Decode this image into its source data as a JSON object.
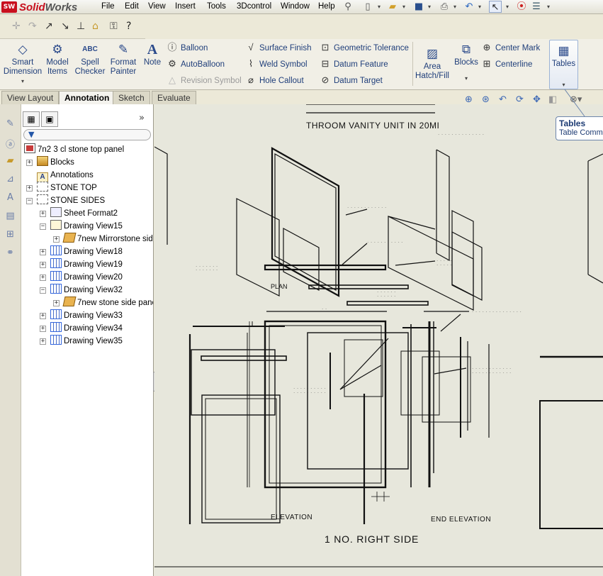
{
  "app": {
    "brand_ds": "SW",
    "brand_solid": "Solid",
    "brand_works": "Works"
  },
  "menu": [
    "File",
    "Edit",
    "View",
    "Insert",
    "Tools",
    "3Dcontrol",
    "Window",
    "Help"
  ],
  "ribbon": {
    "smart_dimension": "Smart Dimension",
    "model_items": "Model Items",
    "spell_checker": "Spell Checker",
    "format_painter": "Format Painter",
    "note": "Note",
    "balloon": "Balloon",
    "autoballoon": "AutoBalloon",
    "revision_symbol": "Revision Symbol",
    "surface_finish": "Surface Finish",
    "weld_symbol": "Weld Symbol",
    "hole_callout": "Hole Callout",
    "geometric_tolerance": "Geometric Tolerance",
    "datum_feature": "Datum Feature",
    "datum_target": "Datum Target",
    "area_hatch": "Area Hatch/Fill",
    "blocks": "Blocks",
    "center_mark": "Center Mark",
    "centerline": "Centerline",
    "tables": "Tables",
    "abc": "ABC"
  },
  "tabs": [
    "View Layout",
    "Annotation",
    "Sketch",
    "Evaluate"
  ],
  "tree": {
    "root": "7n2 3 cl stone top panel",
    "items": [
      {
        "label": "Blocks"
      },
      {
        "label": "Annotations"
      },
      {
        "label": "STONE TOP"
      },
      {
        "label": "STONE SIDES"
      },
      {
        "label": "Sheet Format2"
      },
      {
        "label": "Drawing View15"
      },
      {
        "label": "7new Mirrorstone side"
      },
      {
        "label": "Drawing View18"
      },
      {
        "label": "Drawing View19"
      },
      {
        "label": "Drawing View20"
      },
      {
        "label": "Drawing View32"
      },
      {
        "label": "7new stone side panel"
      },
      {
        "label": "Drawing View33"
      },
      {
        "label": "Drawing View34"
      },
      {
        "label": "Drawing View35"
      }
    ]
  },
  "sheet": {
    "heading": "THROOM VANITY UNIT IN 20MI",
    "plan": "PLAN",
    "elevation": "ELEVATION",
    "end_elevation": "END ELEVATION",
    "title": "1 NO. RIGHT SIDE"
  },
  "tooltip": {
    "title": "Tables",
    "body": "Table Comma"
  },
  "colors": {
    "sheet_bg": "#e7e7dc",
    "ui_bg": "#ece9d8",
    "accent": "#1f3e7a",
    "brand_red": "#c8101e"
  }
}
